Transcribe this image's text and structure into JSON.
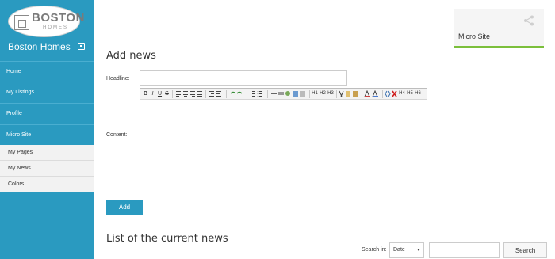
{
  "sidebar": {
    "logo": {
      "main": "BOSTON",
      "sub": "HOMES"
    },
    "brand_link": "Boston Homes",
    "items": [
      {
        "label": "Home"
      },
      {
        "label": "My Listings"
      },
      {
        "label": "Profile"
      },
      {
        "label": "Micro Site"
      }
    ],
    "sub_items": [
      {
        "label": "My Pages"
      },
      {
        "label": "My News"
      },
      {
        "label": "Colors"
      }
    ]
  },
  "card": {
    "title": "Micro Site",
    "icon": "share-icon"
  },
  "add_news": {
    "heading": "Add news",
    "headline_label": "Headline:",
    "headline_value": "",
    "content_label": "Content:",
    "add_button": "Add"
  },
  "toolbar": {
    "bold": "B",
    "italic": "I",
    "underline": "U",
    "strike": "S",
    "h1": "H1",
    "h2": "H2",
    "h3": "H3",
    "h4": "H4",
    "h5": "H5",
    "h6": "H6"
  },
  "list": {
    "heading": "List of the current news",
    "search_in_label": "Search in:",
    "search_in_value": "Date",
    "search_value": "",
    "search_button": "Search"
  },
  "colors": {
    "accent": "#2a9ac0",
    "sidebar": "#2a9ac0",
    "card_border": "#7bbf3b"
  }
}
